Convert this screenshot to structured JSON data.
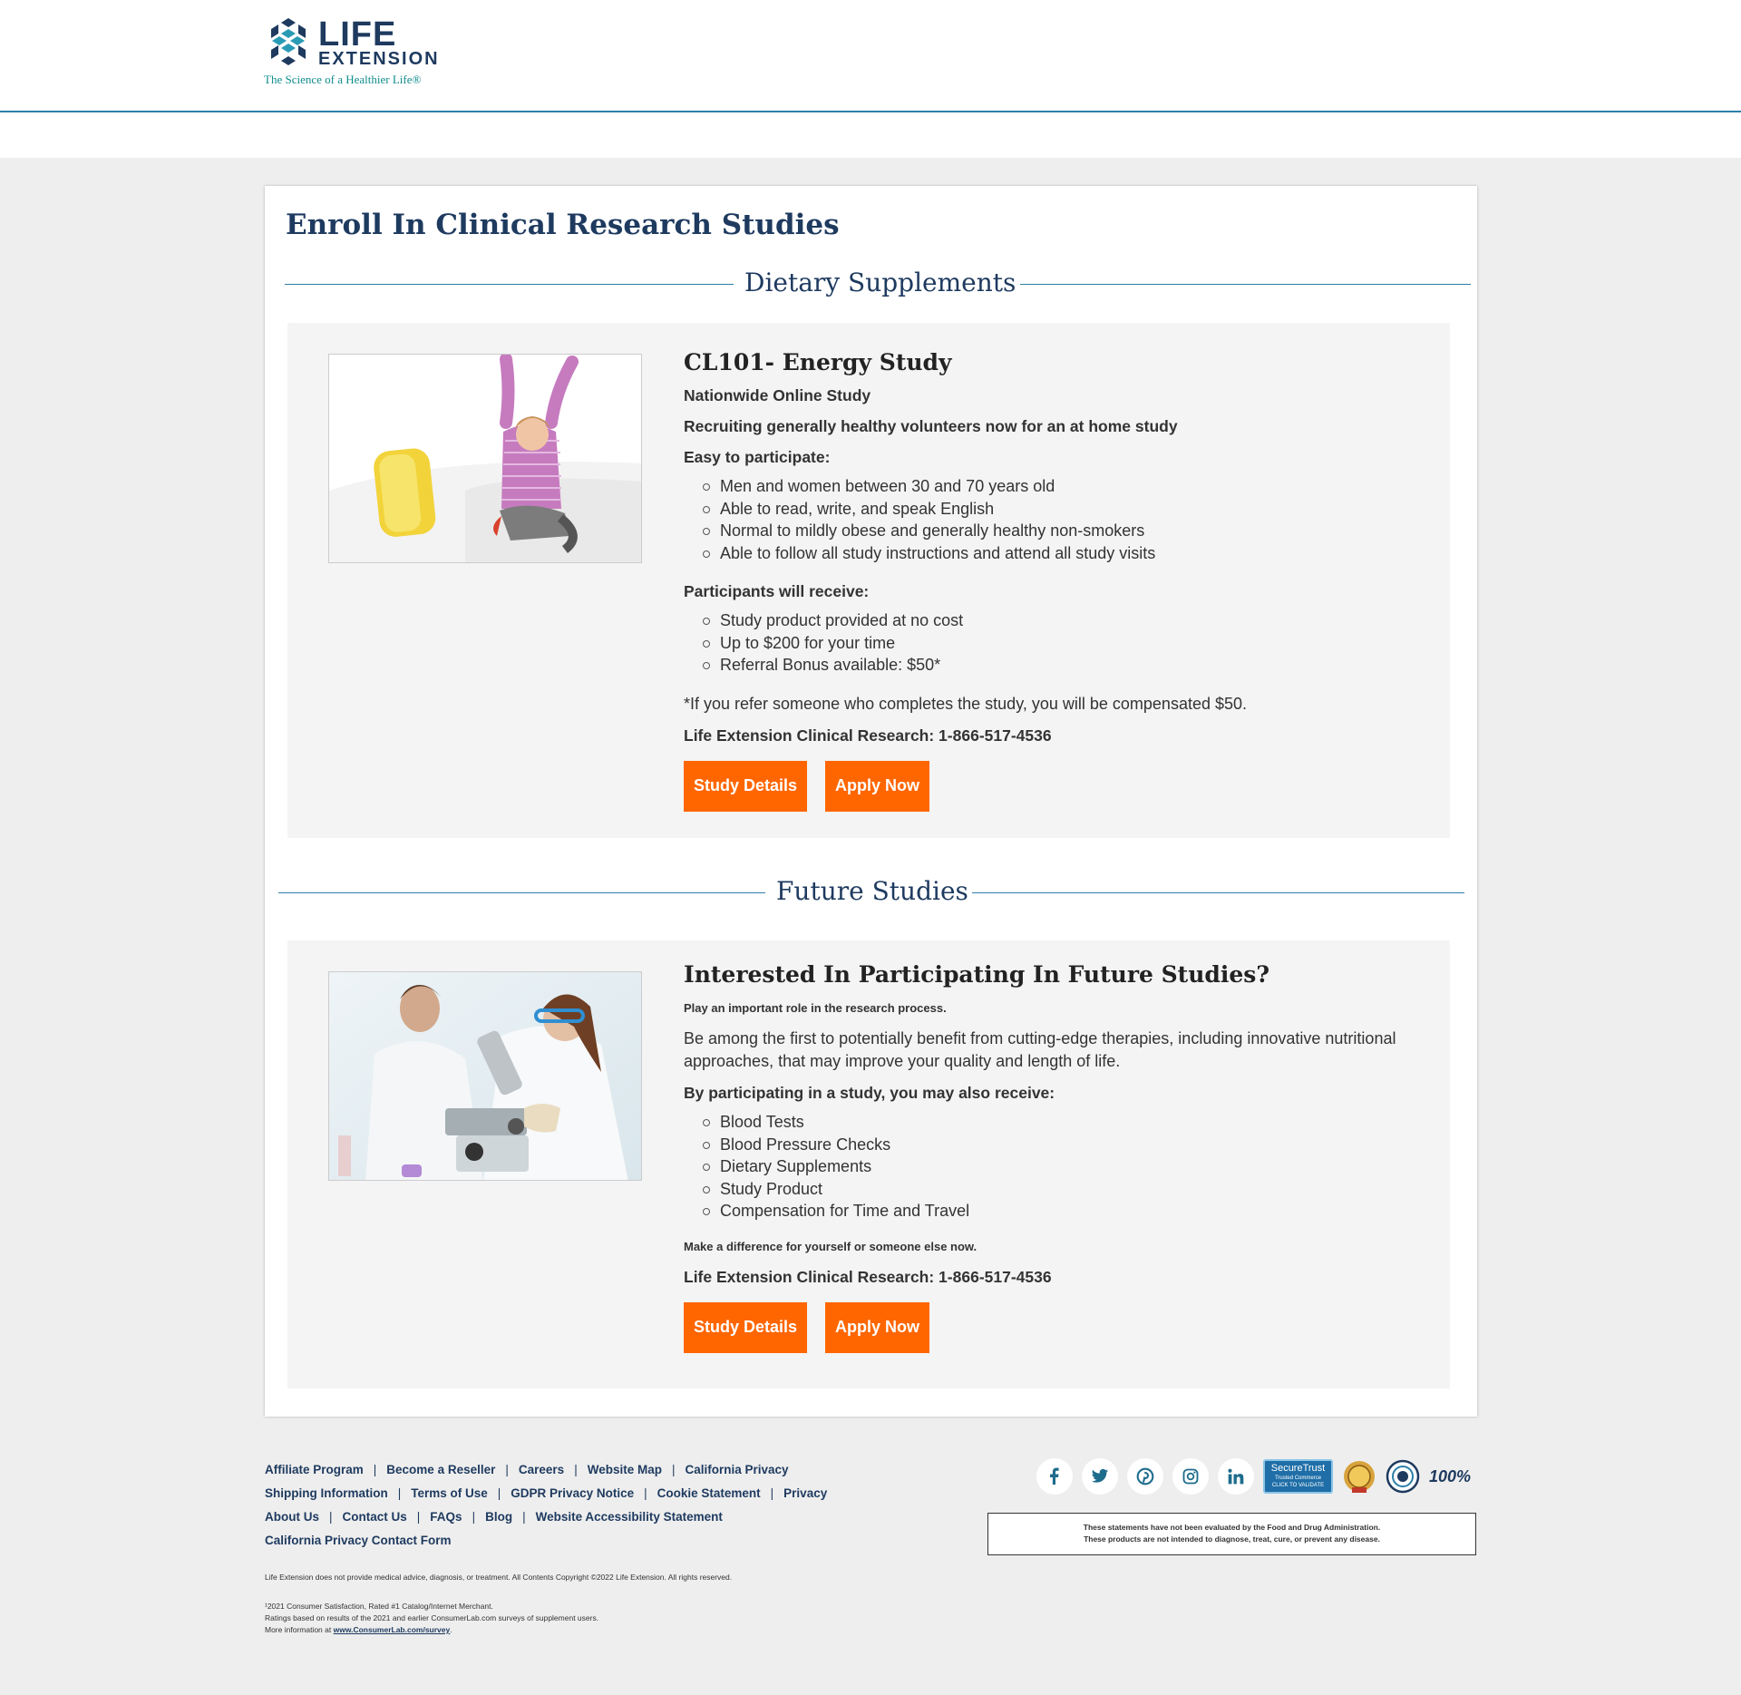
{
  "header": {
    "logo_life": "LIFE",
    "logo_extension": "EXTENSION",
    "logo_tagline": "The Science of a Healthier Life®"
  },
  "page": {
    "title": "Enroll In Clinical Research Studies"
  },
  "sections": {
    "dietary": {
      "heading": "Dietary Supplements",
      "study": {
        "title": "CL101- Energy Study",
        "subtitle": "Nationwide Online Study",
        "recruiting": "Recruiting generally healthy volunteers now for an at home study",
        "easy_heading": "Easy to participate:",
        "criteria": [
          "Men and women between 30 and 70 years old",
          "Able to read, write, and speak English",
          "Normal to mildly obese and generally healthy non-smokers",
          "Able to follow all study instructions and attend all study visits"
        ],
        "receive_heading": "Participants will receive:",
        "benefits": [
          "Study product provided at no cost",
          "Up to $200 for your time",
          "Referral Bonus available: $50*"
        ],
        "referral_note": "*If you refer someone who completes the study, you will be compensated $50.",
        "contact": "Life Extension Clinical Research: 1-866-517-4536",
        "details_button": "Study Details",
        "apply_button": "Apply Now"
      }
    },
    "future": {
      "heading": "Future Studies",
      "study": {
        "title": "Interested In Participating In Future Studies?",
        "intro": "Play an important role in the research process.",
        "body": "Be among the first to potentially benefit from cutting-edge therapies, including innovative nutritional approaches, that may improve your quality and length of life.",
        "receive_heading": "By participating in a study, you may also receive:",
        "benefits": [
          "Blood Tests",
          "Blood Pressure Checks",
          "Dietary Supplements",
          "Study Product",
          "Compensation for Time and Travel"
        ],
        "closing": "Make a difference for yourself or someone else now.",
        "contact": "Life Extension Clinical Research: 1-866-517-4536",
        "details_button": "Study Details",
        "apply_button": "Apply Now"
      }
    }
  },
  "footer": {
    "links_row1": [
      "Affiliate Program",
      "Become a Reseller",
      "Careers",
      "Website Map",
      "California Privacy"
    ],
    "links_row2": [
      "Shipping Information",
      "Terms of Use",
      "GDPR Privacy Notice",
      "Cookie Statement",
      "Privacy"
    ],
    "links_row3": [
      "About Us",
      "Contact Us",
      "FAQs",
      "Blog",
      "Website Accessibility Statement"
    ],
    "links_row4": [
      "California Privacy Contact Form"
    ],
    "separator": "|",
    "copyright": "Life Extension does not provide medical advice, diagnosis, or treatment. All Contents Copyright ©2022 Life Extension. All rights reserved.",
    "survey_line1": "¹2021 Consumer Satisfaction, Rated #1 Catalog/Internet Merchant.",
    "survey_line2": "Ratings based on results of the 2021 and earlier ConsumerLab.com surveys of supplement users.",
    "survey_line3_prefix": "More information at ",
    "survey_link": "www.ConsumerLab.com/survey",
    "survey_line3_suffix": ".",
    "disclaimer_line1": "These statements have not been evaluated by the Food and Drug Administration.",
    "disclaimer_line2": "These products are not intended to diagnose, treat, cure, or prevent any disease.",
    "social_icons": [
      "facebook-icon",
      "twitter-icon",
      "pinterest-icon",
      "instagram-icon",
      "linkedin-icon"
    ],
    "trust_badge_title": "SecureTrust",
    "trust_badge_sub1": "Trusted Commerce",
    "trust_badge_sub2": "CLICK TO VALIDATE",
    "guarantee_badge": "100%"
  },
  "colors": {
    "brand_navy": "#1e3a5f",
    "accent_teal": "#0f8c8c",
    "rule_blue": "#2a7fa8",
    "button_orange": "#ff6600"
  }
}
